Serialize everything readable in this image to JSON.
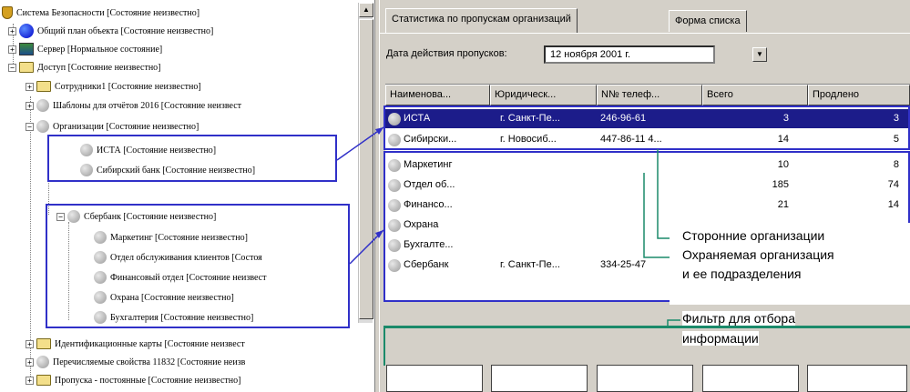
{
  "tree": {
    "items": [
      {
        "label": "Система Безопасности [Состояние неизвестно]"
      },
      {
        "label": "Общий план объекта [Состояние неизвестно]"
      },
      {
        "label": "Сервер [Нормальное состояние]"
      },
      {
        "label": "Доступ [Состояние неизвестно]"
      },
      {
        "label": "Сотрудники1 [Состояние неизвестно]"
      },
      {
        "label": "Шаблоны для отчётов 2016 [Состояние неизвест"
      },
      {
        "label": "Организации [Состояние неизвестно]"
      },
      {
        "label": "ИСТА [Состояние неизвестно]"
      },
      {
        "label": "Сибирский банк [Состояние неизвестно]"
      },
      {
        "label": "Сбербанк [Состояние неизвестно]"
      },
      {
        "label": "Маркетинг [Состояние неизвестно]"
      },
      {
        "label": "Отдел обслуживания клиентов [Состоя"
      },
      {
        "label": "Финансовый отдел [Состояние неизвест"
      },
      {
        "label": "Охрана [Состояние неизвестно]"
      },
      {
        "label": "Бухгалтерия [Состояние неизвестно]"
      },
      {
        "label": "Идентификационные карты [Состояние неизвест"
      },
      {
        "label": "Перечисляемые свойства 11832 [Состояние неизв"
      },
      {
        "label": "Пропуска - постоянные [Состояние неизвестно]"
      }
    ],
    "expanders": {
      "plus": "+",
      "minus": "−"
    },
    "scroll_up": "▲"
  },
  "tabs": {
    "stats": "Статистика по пропускам организаций",
    "list": "Форма списка"
  },
  "date": {
    "label": "Дата действия пропусков:",
    "value": "12  ноября  2001 г.",
    "dropdown": "▼"
  },
  "grid": {
    "headers": [
      "Наименова...",
      "Юридическ...",
      "N№ телеф...",
      "Всего",
      "Продлено"
    ],
    "rows": [
      {
        "name": "ИСТА",
        "city": "г. Санкт-Пе...",
        "phone": "246-96-61",
        "total": "3",
        "ext": "3"
      },
      {
        "name": "Сибирски...",
        "city": "г. Новосиб...",
        "phone": "447-86-11 4...",
        "total": "14",
        "ext": "5"
      },
      {
        "name": "Маркетинг",
        "city": "",
        "phone": "",
        "total": "10",
        "ext": "8"
      },
      {
        "name": "Отдел об...",
        "city": "",
        "phone": "",
        "total": "185",
        "ext": "74"
      },
      {
        "name": "Финансо...",
        "city": "",
        "phone": "",
        "total": "21",
        "ext": "14"
      },
      {
        "name": "Охрана",
        "city": "",
        "phone": "",
        "total": "",
        "ext": ""
      },
      {
        "name": "Бухгалте...",
        "city": "",
        "phone": "",
        "total": "",
        "ext": ""
      },
      {
        "name": "Сбербанк",
        "city": "г. Санкт-Пе...",
        "phone": "334-25-47",
        "total": "",
        "ext": ""
      }
    ]
  },
  "annotations": {
    "third_party": "Сторонние организации",
    "protected_1": "Охраняемая организация",
    "protected_2": "и ее подразделения",
    "filter_1": "Фильтр для отбора",
    "filter_2": "информации"
  },
  "colors": {
    "selection": "#1c1c8a",
    "highlight": "#3030c8",
    "callout_line": "#1a8a6a"
  }
}
